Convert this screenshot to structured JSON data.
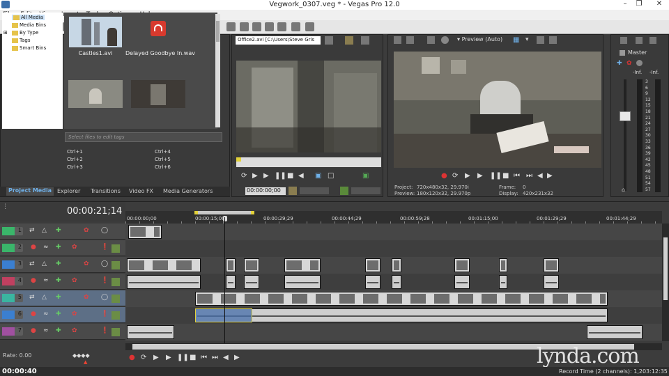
{
  "window": {
    "title": "Vegwork_0307.veg * - Vegas Pro 12.0"
  },
  "menu": [
    "File",
    "Edit",
    "View",
    "Insert",
    "Tools",
    "Options",
    "Help"
  ],
  "project_media": {
    "tree": [
      "All Media",
      "Media Bins",
      "By Type",
      "Tags",
      "Smart Bins"
    ],
    "items": [
      {
        "label": "Castles1.avi"
      },
      {
        "label": "Delayed Goodbye In.wav"
      }
    ],
    "tags_placeholder": "Select files to edit tags",
    "shortcuts": [
      "Ctrl+1",
      "Ctrl+2",
      "Ctrl+3",
      "Ctrl+4",
      "Ctrl+5",
      "Ctrl+6"
    ]
  },
  "dock_tabs": [
    "Project Media",
    "Explorer",
    "Transitions",
    "Video FX",
    "Media Generators"
  ],
  "trimmer": {
    "file": "Office2.avi",
    "path": "[C:\\Users\\Steve Gris",
    "timecode": "00:00:00;00"
  },
  "preview": {
    "quality": "Preview (Auto)",
    "project_label": "Project:",
    "project_value": "720x480x32, 29.970i",
    "preview_label": "Preview:",
    "preview_value": "180x120x32, 29.970p",
    "frame_label": "Frame:",
    "frame_value": "0",
    "display_label": "Display:",
    "display_value": "420x231x32"
  },
  "master": {
    "label": "Master",
    "left_inf": "-Inf.",
    "right_inf": "-Inf.",
    "scale": [
      "3",
      "6",
      "9",
      "12",
      "15",
      "18",
      "21",
      "24",
      "27",
      "30",
      "33",
      "36",
      "39",
      "42",
      "45",
      "48",
      "51",
      "54",
      "57"
    ]
  },
  "timeline": {
    "cursor": "00:00:21;14",
    "ruler": [
      "00:00:00;00",
      "00:00:15;00",
      "00:00:29;29",
      "00:00:44;29",
      "00:00:59;28",
      "00:01:15;00",
      "00:01:29;29",
      "00:01:44;29"
    ],
    "tracks": [
      {
        "num": "1",
        "type": "video",
        "color": "#3ab56a"
      },
      {
        "num": "2",
        "type": "audio",
        "color": "#3ab56a"
      },
      {
        "num": "3",
        "type": "video",
        "color": "#3b7fd0"
      },
      {
        "num": "4",
        "type": "audio",
        "color": "#c04060"
      },
      {
        "num": "5",
        "type": "video",
        "color": "#3ab5a0"
      },
      {
        "num": "6",
        "type": "audio",
        "color": "#3b7fd0"
      },
      {
        "num": "7",
        "type": "audio",
        "color": "#a050a0"
      }
    ],
    "rate": "Rate: 0.00",
    "time_display": "00:00:40",
    "record_time": "Record Time (2 channels): 1,203:12:35"
  },
  "watermark": "lynda.com",
  "colors": {
    "accent": "#6fb0e8",
    "workspace": "#3a3a3a"
  }
}
